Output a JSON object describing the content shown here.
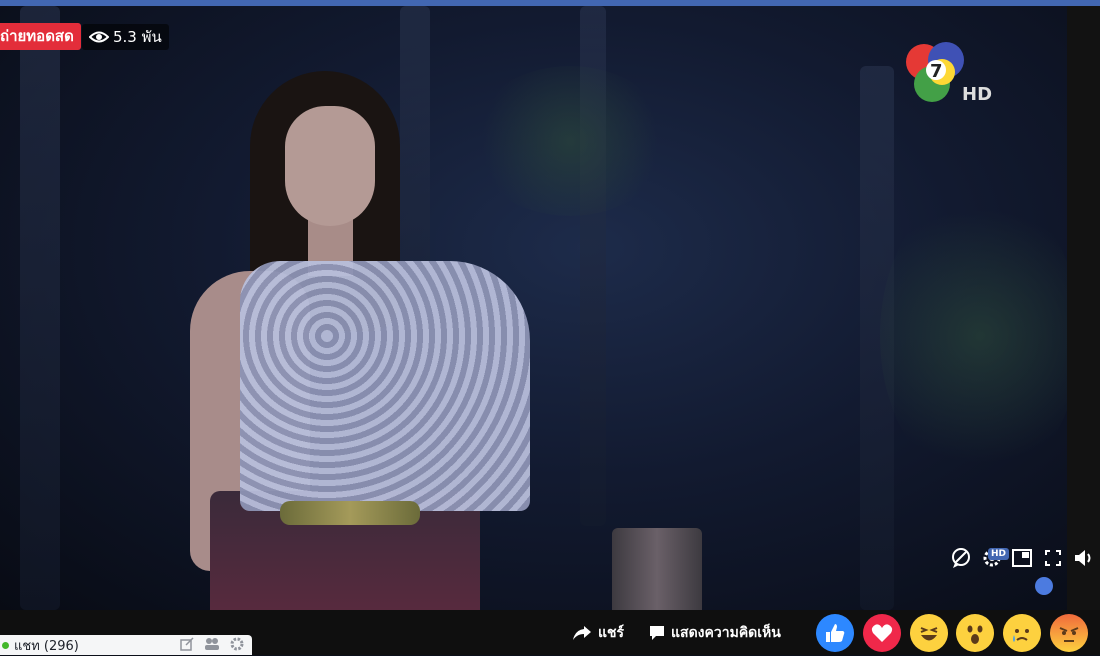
{
  "live_badge": "ถ่ายทอดสด",
  "viewers": "5.3 พัน",
  "channel_logo": "7 HD",
  "controls": {
    "hd_label": "HD"
  },
  "bottom": {
    "chat_label": "แชท (296)",
    "share_label": "แชร์",
    "comment_label": "แสดงความคิดเห็น"
  },
  "reactions": [
    "like",
    "love",
    "haha",
    "wow",
    "sad",
    "angry"
  ],
  "colors": {
    "accent": "#4267b2",
    "live": "#e32d3a",
    "love": "#f0284a",
    "like": "#2d88ff"
  }
}
